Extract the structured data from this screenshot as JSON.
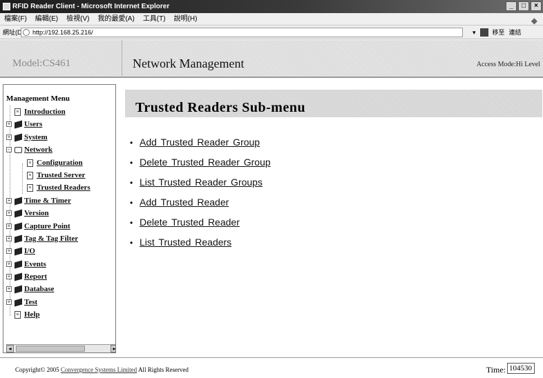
{
  "window": {
    "title": "RFID Reader Client - Microsoft Internet Explorer"
  },
  "menubar": {
    "items": [
      "檔案(F)",
      "編輯(E)",
      "檢視(V)",
      "我的最愛(A)",
      "工具(T)",
      "說明(H)"
    ]
  },
  "address": {
    "label": "網址(D)",
    "url": "http://192.168.25.216/",
    "go_label": "移至",
    "links_label": "連結"
  },
  "header": {
    "model": "Model:CS461",
    "title": "Network Management",
    "access_mode": "Access Mode:Hi Level"
  },
  "sidebar": {
    "title": "Management Menu",
    "items": [
      {
        "label": "Introduction",
        "icon": "document-icon"
      },
      {
        "label": "Users",
        "icon": "book-icon"
      },
      {
        "label": "System",
        "icon": "book-icon"
      },
      {
        "label": "Network",
        "icon": "open-book-icon"
      },
      {
        "label": "Configuration",
        "icon": "document-icon"
      },
      {
        "label": "Trusted Server",
        "icon": "document-icon"
      },
      {
        "label": "Trusted Readers",
        "icon": "document-icon"
      },
      {
        "label": "Time & Timer",
        "icon": "book-icon"
      },
      {
        "label": "Version",
        "icon": "book-icon"
      },
      {
        "label": "Capture Point",
        "icon": "book-icon"
      },
      {
        "label": "Tag & Tag Filter",
        "icon": "book-icon"
      },
      {
        "label": "I/O",
        "icon": "book-icon"
      },
      {
        "label": "Events",
        "icon": "book-icon"
      },
      {
        "label": "Report",
        "icon": "book-icon"
      },
      {
        "label": "Database",
        "icon": "book-icon"
      },
      {
        "label": "Test",
        "icon": "book-icon"
      },
      {
        "label": "Help",
        "icon": "document-icon"
      }
    ]
  },
  "content": {
    "subtitle": "Trusted Readers Sub-menu",
    "links": [
      "Add Trusted Reader Group",
      "Delete Trusted Reader Group",
      "List Trusted Reader Groups",
      "Add Trusted Reader",
      "Delete Trusted Reader",
      "List Trusted Readers"
    ]
  },
  "footer": {
    "copyright_prefix": "Copyright© 2005",
    "company": "Convergence Systems Limited",
    "rights": "All Rights Reserved",
    "time_label": "Time:",
    "time_value": "104530"
  }
}
